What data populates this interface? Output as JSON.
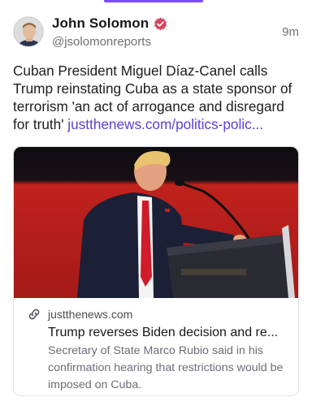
{
  "author": {
    "display_name": "John Solomon",
    "handle": "@jsolomonreports",
    "verified": true
  },
  "post": {
    "timestamp": "9m",
    "text": "Cuban President Miguel Díaz-Canel calls Trump reinstating Cuba as a state sponsor of terrorism 'an act of arrogance and disregard for truth' ",
    "link_text": "justthenews.com/politics-polic..."
  },
  "card": {
    "domain": "justthenews.com",
    "title": "Trump reverses Biden decision and re...",
    "description": "Secretary of State Marco Rubio said in his confirmation hearing that restrictions would be imposed on Cuba."
  },
  "colors": {
    "accent": "#7c4dff",
    "link": "#5b3fd9",
    "verified_badge": "#d9455f"
  },
  "icons": {
    "verified": "verified-badge-icon",
    "link": "link-icon"
  }
}
